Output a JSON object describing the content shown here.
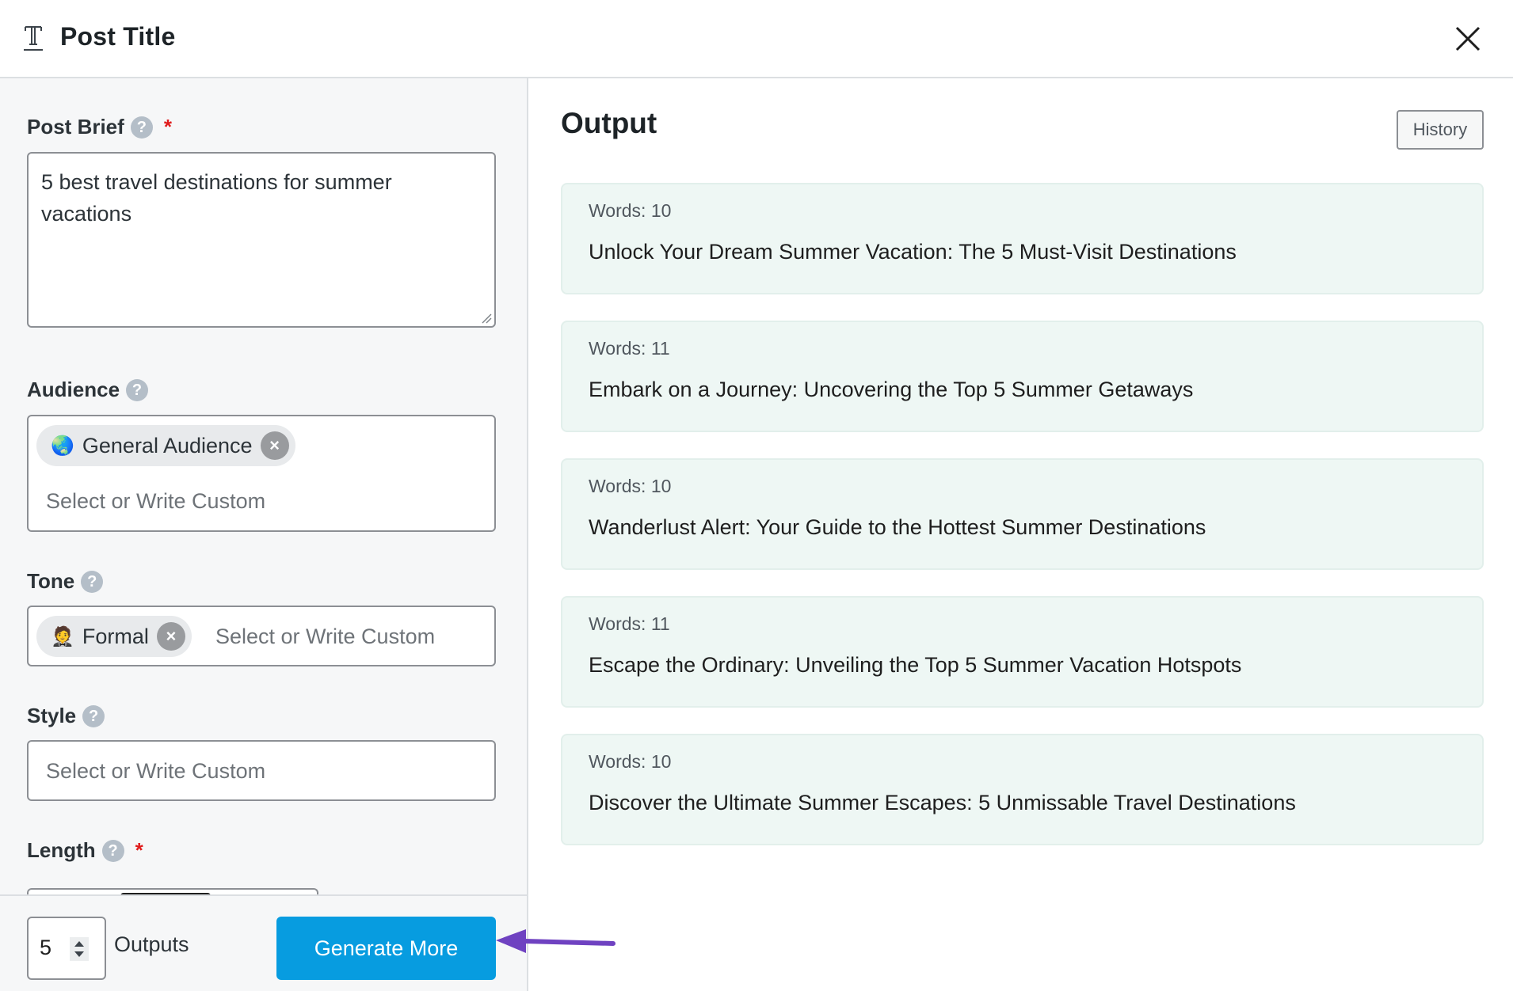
{
  "header": {
    "title": "Post Title",
    "title_icon": "text-type-icon",
    "close_icon": "close-icon"
  },
  "form": {
    "post_brief": {
      "label": "Post Brief",
      "required_mark": "*",
      "value": "5 best travel destinations for summer vacations"
    },
    "audience": {
      "label": "Audience",
      "chips": [
        {
          "emoji": "🌏",
          "label": "General Audience"
        }
      ],
      "placeholder": "Select or Write Custom"
    },
    "tone": {
      "label": "Tone",
      "chips": [
        {
          "emoji": "🤵",
          "label": "Formal"
        }
      ],
      "placeholder": "Select or Write Custom"
    },
    "style": {
      "label": "Style",
      "placeholder": "Select or Write Custom"
    },
    "length": {
      "label": "Length",
      "required_mark": "*"
    },
    "help_glyph": "?",
    "chip_remove_glyph": "×"
  },
  "footer": {
    "outputs_value": "5",
    "outputs_label": "Outputs",
    "generate_label": "Generate More"
  },
  "output": {
    "title": "Output",
    "history_label": "History",
    "results": [
      {
        "words": "Words: 10",
        "text": "Unlock Your Dream Summer Vacation: The 5 Must-Visit Destinations"
      },
      {
        "words": "Words: 11",
        "text": "Embark on a Journey: Uncovering the Top 5 Summer Getaways"
      },
      {
        "words": "Words: 10",
        "text": "Wanderlust Alert: Your Guide to the Hottest Summer Destinations"
      },
      {
        "words": "Words: 11",
        "text": "Escape the Ordinary: Unveiling the Top 5 Summer Vacation Hotspots"
      },
      {
        "words": "Words: 10",
        "text": "Discover the Ultimate Summer Escapes: 5 Unmissable Travel Destinations"
      }
    ]
  },
  "colors": {
    "primary_button": "#079ce0",
    "annotation_arrow": "#6f42c1",
    "required": "#e01b1b",
    "card_bg": "#eef7f4"
  }
}
